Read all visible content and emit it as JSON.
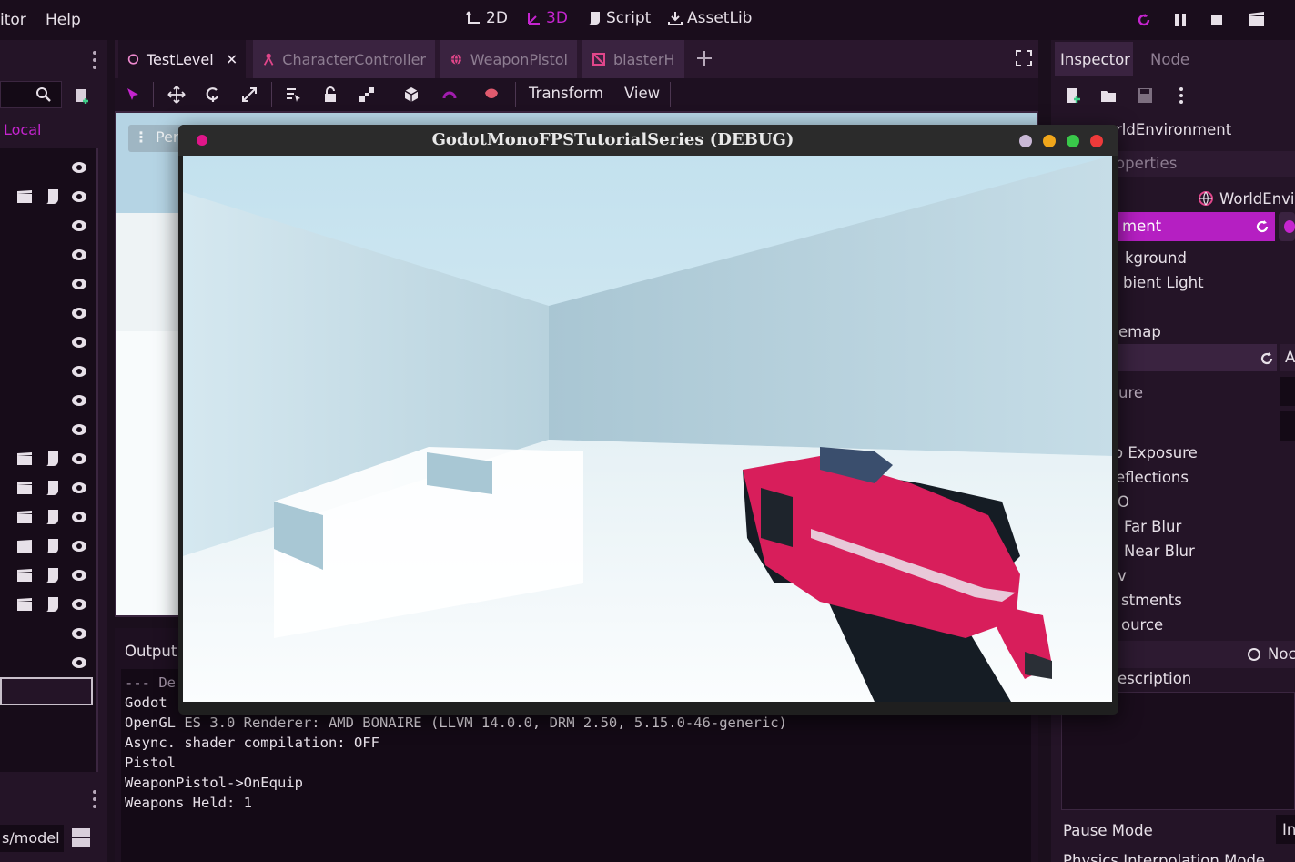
{
  "menubar": {
    "items": [
      "itor",
      "Help"
    ]
  },
  "workspace_modes": [
    {
      "label": "2D",
      "icon": "2d-icon",
      "active": false
    },
    {
      "label": "3D",
      "icon": "3d-icon",
      "active": true
    },
    {
      "label": "Script",
      "icon": "script-icon",
      "active": false
    },
    {
      "label": "AssetLib",
      "icon": "assetlib-icon",
      "active": false
    }
  ],
  "colors": {
    "accent": "#c524cf",
    "accent_dark": "#a21caf",
    "gun_red": "#d81e5b",
    "bg": "#1b0f1d"
  },
  "scene_dock": {
    "local_label": "Local"
  },
  "scene_tabs": [
    {
      "label": "TestLevel",
      "icon": "node3d-icon",
      "active": true
    },
    {
      "label": "CharacterController",
      "icon": "character-icon",
      "active": false
    },
    {
      "label": "WeaponPistol",
      "icon": "globe-icon",
      "active": false
    },
    {
      "label": "blasterH",
      "icon": "mesh-icon",
      "active": false
    }
  ],
  "toolbar": {
    "transform_label": "Transform",
    "view_label": "View"
  },
  "viewport": {
    "perspective_label": "Per"
  },
  "output": {
    "title": "Output:",
    "lines": [
      "--- De",
      "Godot",
      "OpenGL ES 3.0 Renderer: AMD BONAIRE (LLVM 14.0.0, DRM 2.50, 5.15.0-46-generic)",
      "Async. shader compilation: OFF",
      "",
      "Pistol",
      "WeaponPistol->OnEquip",
      "Weapons Held: 1"
    ]
  },
  "filesystem_dock": {
    "path": "s/model"
  },
  "inspector": {
    "tabs": [
      "Inspector",
      "Node"
    ],
    "node_name": "rldEnvironment",
    "properties_filter": "operties",
    "class_label": "WorldEnvi",
    "section_label": "ment",
    "rows": [
      "kground",
      "bient Light",
      "",
      "emap"
    ],
    "rows2": [
      "ure",
      "",
      "o Exposure",
      "eflections",
      "O",
      "Far Blur",
      "Near Blur",
      "v",
      "stments",
      "ource"
    ],
    "node_section": "Noc",
    "description": "escription",
    "pause_mode_label": "Pause Mode",
    "pause_mode_value": "In",
    "physics_label": "Physics Interpolation Mode"
  },
  "game_window": {
    "title": "GodotMonoFPSTutorialSeries (DEBUG)"
  }
}
